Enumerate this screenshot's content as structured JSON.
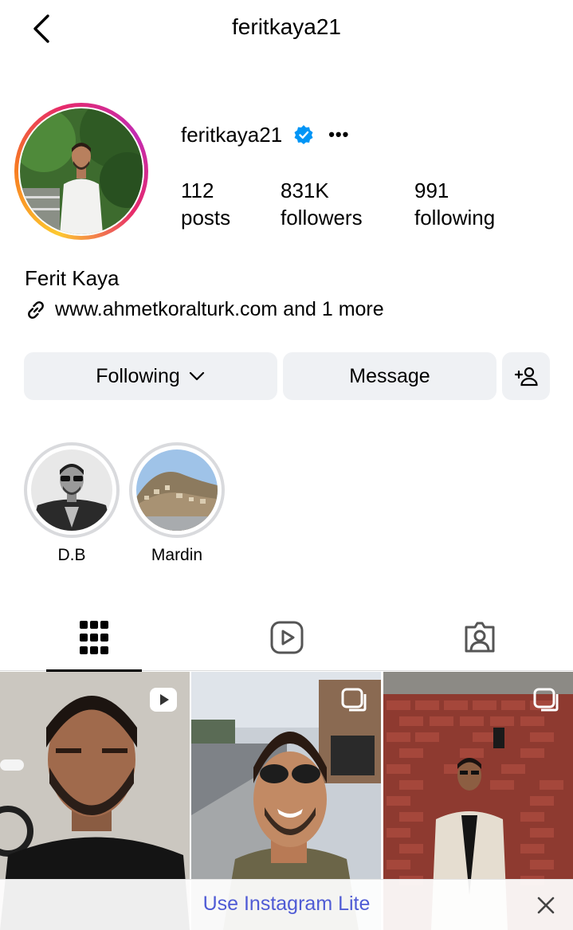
{
  "header": {
    "title": "feritkaya21",
    "back_icon": "chevron-left-icon"
  },
  "profile": {
    "username": "feritkaya21",
    "verified_icon": "verified-badge-icon",
    "more_label": "•••",
    "stats": {
      "posts_value": "112",
      "posts_label": "posts",
      "followers_value": "831K",
      "followers_label": "followers",
      "following_value": "991",
      "following_label": "following"
    },
    "full_name": "Ferit Kaya",
    "link_text": "www.ahmetkoralturk.com and 1 more"
  },
  "actions": {
    "following_label": "Following",
    "message_label": "Message",
    "add_user_icon": "add-user-icon"
  },
  "highlights": [
    {
      "label": "D.B"
    },
    {
      "label": "Mardin"
    }
  ],
  "tabs": [
    "grid-icon",
    "reels-icon",
    "tagged-icon"
  ],
  "banner": {
    "text": "Use Instagram Lite",
    "close_icon": "close-icon"
  },
  "colors": {
    "accent_blue": "#4f5bd5",
    "verified_blue": "#0095f6",
    "button_bg": "#eff1f4"
  }
}
